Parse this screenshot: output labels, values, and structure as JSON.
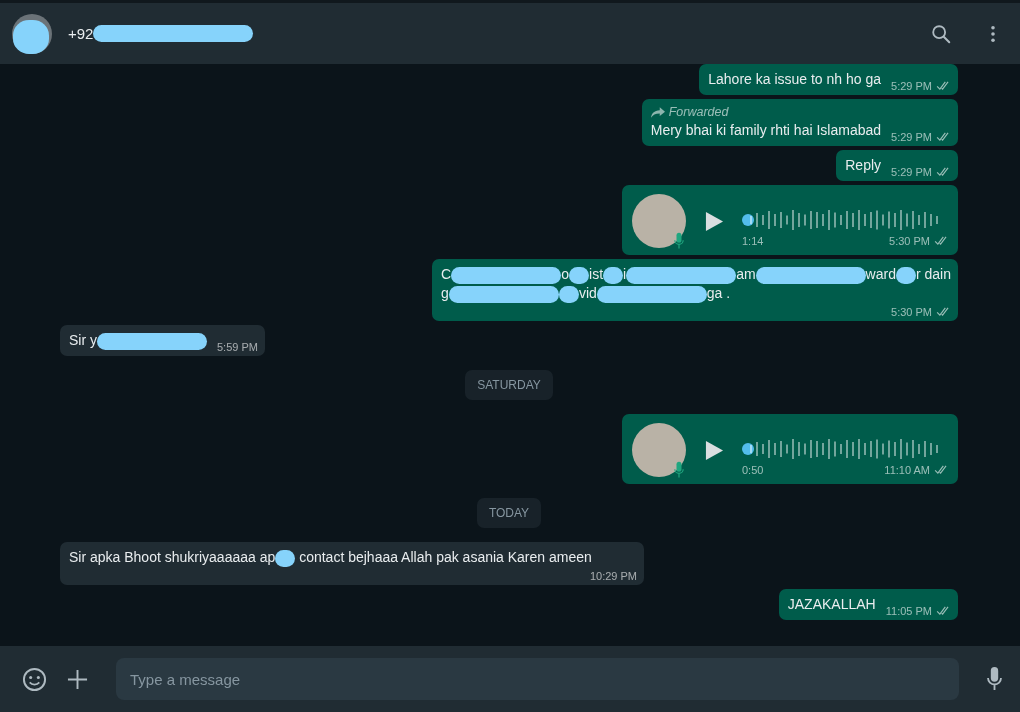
{
  "header": {
    "title": [
      {
        "kind": "text",
        "text": "+92"
      },
      {
        "kind": "redacted",
        "wide": true
      }
    ]
  },
  "messages": [
    {
      "kind": "text",
      "outgoing": true,
      "lines": [
        [
          {
            "kind": "text",
            "text": "Lahore ka issue to nh ho ga"
          }
        ]
      ],
      "time": "5:29 PM"
    },
    {
      "kind": "text",
      "outgoing": true,
      "forwarded": "Forwarded",
      "lines": [
        [
          {
            "kind": "text",
            "text": "Mery bhai ki family rhti hai Islamabad"
          }
        ]
      ],
      "time": "5:29 PM"
    },
    {
      "kind": "text",
      "outgoing": true,
      "lines": [
        [
          {
            "kind": "text",
            "text": "Reply"
          }
        ]
      ],
      "time": "5:29 PM"
    },
    {
      "kind": "voice",
      "outgoing": true,
      "duration": "1:14",
      "time": "5:30 PM"
    },
    {
      "kind": "text",
      "outgoing": true,
      "lines": [
        [
          {
            "kind": "text",
            "text": "C"
          },
          {
            "kind": "redacted",
            "wide": true
          },
          {
            "kind": "text",
            "text": "o"
          },
          {
            "kind": "redacted",
            "wide": false
          },
          {
            "kind": "text",
            "text": "ist"
          },
          {
            "kind": "redacted",
            "wide": false
          },
          {
            "kind": "text",
            "text": "i"
          },
          {
            "kind": "redacted",
            "wide": true
          },
          {
            "kind": "text",
            "text": "am"
          },
          {
            "kind": "redacted",
            "wide": true
          },
          {
            "kind": "text",
            "text": "ward"
          },
          {
            "kind": "redacted",
            "wide": false
          },
          {
            "kind": "text",
            "text": "r dain"
          }
        ],
        [
          {
            "kind": "text",
            "text": "g"
          },
          {
            "kind": "redacted",
            "wide": true
          },
          {
            "kind": "redacted",
            "wide": false
          },
          {
            "kind": "text",
            "text": "vid"
          },
          {
            "kind": "redacted",
            "wide": true
          },
          {
            "kind": "text",
            "text": "ga ."
          }
        ]
      ],
      "time": "5:30 PM"
    },
    {
      "kind": "text",
      "outgoing": false,
      "lines": [
        [
          {
            "kind": "text",
            "text": "Sir y"
          },
          {
            "kind": "redacted",
            "wide": true
          }
        ]
      ],
      "time": "5:59 PM"
    },
    {
      "kind": "date",
      "label": "SATURDAY"
    },
    {
      "kind": "voice",
      "outgoing": true,
      "duration": "0:50",
      "time": "11:10 AM"
    },
    {
      "kind": "date",
      "label": "TODAY"
    },
    {
      "kind": "text",
      "outgoing": false,
      "lines": [
        [
          {
            "kind": "text",
            "text": "Sir apka Bhoot shukriyaaaaaa ap"
          },
          {
            "kind": "redacted",
            "wide": false
          },
          {
            "kind": "text",
            "text": " contact bejhaaa Allah pak asania Karen ameen"
          }
        ]
      ],
      "time": "10:29 PM"
    },
    {
      "kind": "text",
      "outgoing": true,
      "lines": [
        [
          {
            "kind": "text",
            "text": "JAZAKALLAH"
          }
        ]
      ],
      "time": "11:05 PM"
    }
  ],
  "composer": {
    "placeholder": "Type a message"
  }
}
